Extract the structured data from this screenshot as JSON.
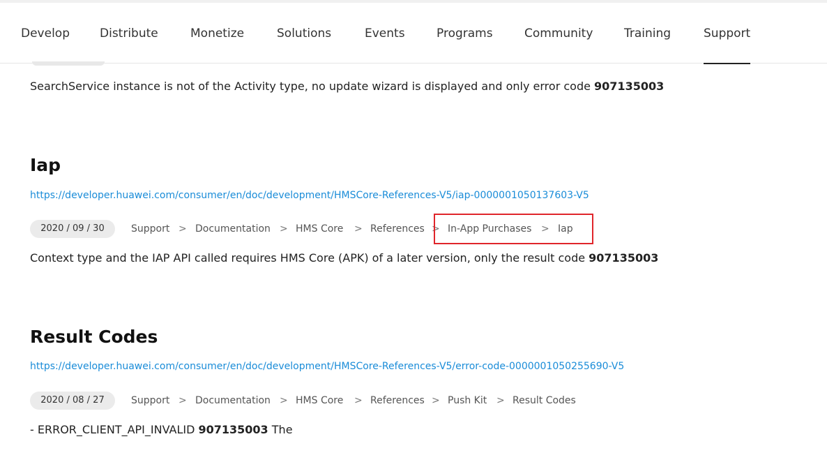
{
  "nav": {
    "items": [
      {
        "label": "Develop"
      },
      {
        "label": "Distribute"
      },
      {
        "label": "Monetize"
      },
      {
        "label": "Solutions"
      },
      {
        "label": "Events"
      },
      {
        "label": "Programs"
      },
      {
        "label": "Community"
      },
      {
        "label": "Training"
      },
      {
        "label": "Support",
        "active": true
      }
    ]
  },
  "top_snippet": {
    "text": "SearchService instance is not of the Activity type, no update wizard is displayed and only error code ",
    "code": "907135003"
  },
  "results": [
    {
      "title": "Iap",
      "url": "https://developer.huawei.com/consumer/en/doc/development/HMSCore-References-V5/iap-0000001050137603-V5",
      "date": "2020 / 09 / 30",
      "breadcrumbs": [
        "Support",
        "Documentation",
        "HMS Core",
        "References",
        "In-App Purchases",
        "Iap"
      ],
      "snippet_text": "Context type and the IAP API called requires HMS Core (APK) of a later version, only the result code ",
      "snippet_code": "907135003",
      "snippet_after": ""
    },
    {
      "title": "Result Codes",
      "url": "https://developer.huawei.com/consumer/en/doc/development/HMSCore-References-V5/error-code-0000001050255690-V5",
      "date": "2020 / 08 / 27",
      "breadcrumbs": [
        "Support",
        "Documentation",
        "HMS Core",
        "References",
        "Push Kit",
        "Result Codes"
      ],
      "snippet_text": "- ERROR_CLIENT_API_INVALID ",
      "snippet_code": "907135003",
      "snippet_after": " The"
    }
  ],
  "breadcrumb_separator": ">",
  "colors": {
    "link": "#1a8cd8",
    "highlight": "#e0252b",
    "badge_bg": "#ebebeb"
  }
}
